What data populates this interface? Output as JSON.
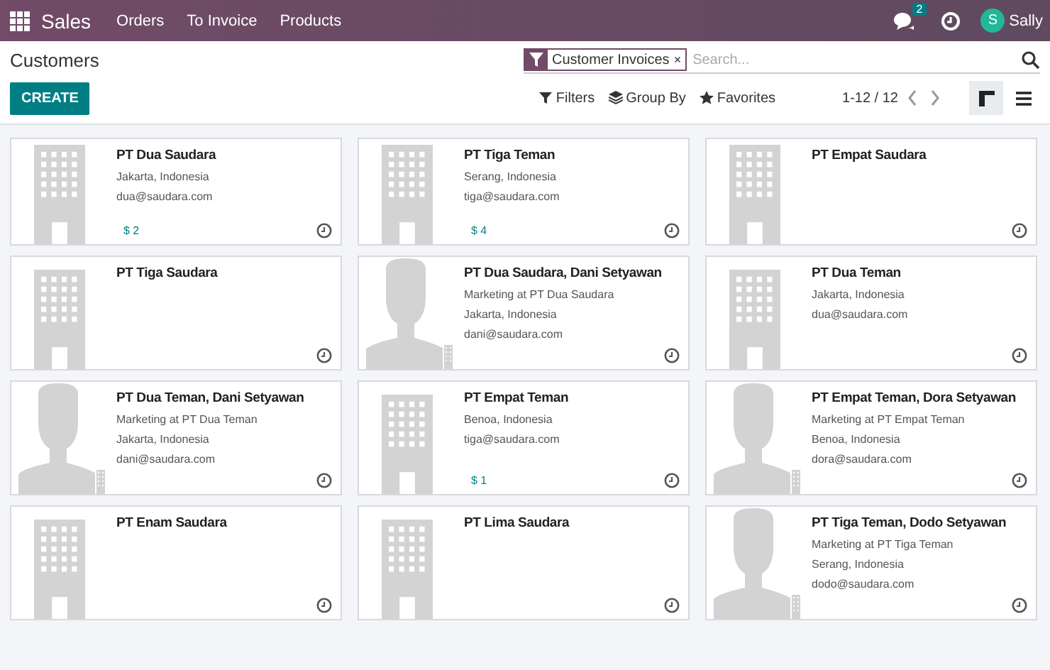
{
  "navbar": {
    "app": "Sales",
    "menu": [
      "Orders",
      "To Invoice",
      "Products"
    ],
    "messages_badge": "2",
    "user": {
      "initial": "S",
      "name": "Sally"
    }
  },
  "control_panel": {
    "title": "Customers",
    "create": "CREATE",
    "search": {
      "facet": "Customer Invoices",
      "remove": "×",
      "placeholder": "Search..."
    },
    "filters": [
      {
        "label": "Filters",
        "kind": "filter"
      },
      {
        "label": "Group By",
        "kind": "layers"
      },
      {
        "label": "Favorites",
        "kind": "star"
      }
    ],
    "pager": "1-12 / 12",
    "views": [
      {
        "kind": "kanban",
        "selected": true
      },
      {
        "kind": "list",
        "selected": false
      }
    ]
  },
  "cards": [
    {
      "kind": "company",
      "name": "PT Dua Saudara",
      "lines": [
        "Jakarta, Indonesia",
        "dua@saudara.com"
      ],
      "amount": "$ 2"
    },
    {
      "kind": "company",
      "name": "PT Tiga Teman",
      "lines": [
        "Serang, Indonesia",
        "tiga@saudara.com"
      ],
      "amount": "$ 4"
    },
    {
      "kind": "company",
      "name": "PT Empat Saudara"
    },
    {
      "kind": "company",
      "name": "PT Tiga Saudara"
    },
    {
      "kind": "person",
      "name": "PT Dua Saudara, Dani Setyawan",
      "lines": [
        "Marketing at PT Dua Saudara",
        "Jakarta, Indonesia",
        "dani@saudara.com"
      ]
    },
    {
      "kind": "company",
      "name": "PT Dua Teman",
      "lines": [
        "Jakarta, Indonesia",
        "dua@saudara.com"
      ]
    },
    {
      "kind": "person",
      "name": "PT Dua Teman, Dani Setyawan",
      "lines": [
        "Marketing at PT Dua Teman",
        "Jakarta, Indonesia",
        "dani@saudara.com"
      ]
    },
    {
      "kind": "company",
      "name": "PT Empat Teman",
      "lines": [
        "Benoa, Indonesia",
        "tiga@saudara.com"
      ],
      "amount": "$ 1"
    },
    {
      "kind": "person",
      "name": "PT Empat Teman, Dora Setyawan",
      "lines": [
        "Marketing at PT Empat Teman",
        "Benoa, Indonesia",
        "dora@saudara.com"
      ]
    },
    {
      "kind": "company",
      "name": "PT Enam Saudara"
    },
    {
      "kind": "company",
      "name": "PT Lima Saudara"
    },
    {
      "kind": "person",
      "name": "PT Tiga Teman, Dodo Setyawan",
      "lines": [
        "Marketing at PT Tiga Teman",
        "Serang, Indonesia",
        "dodo@saudara.com"
      ]
    }
  ]
}
